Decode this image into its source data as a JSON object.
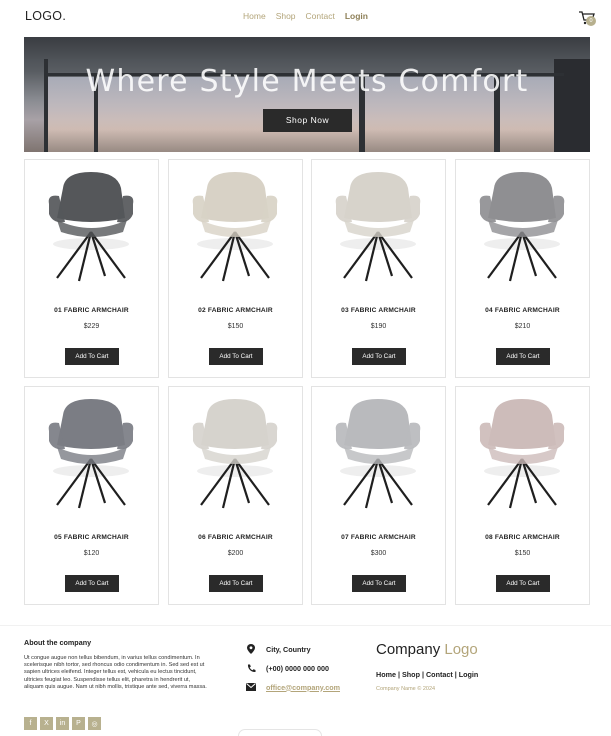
{
  "header": {
    "logo": "LOGO.",
    "nav": [
      "Home",
      "Shop",
      "Contact",
      "Login"
    ],
    "cart_count": "0"
  },
  "hero": {
    "title": "Where Style Meets Comfort",
    "button": "Shop Now"
  },
  "products": [
    {
      "name": "01 FABRIC ARMCHAIR",
      "price": "$229",
      "button": "Add To Cart",
      "color": "#55575a"
    },
    {
      "name": "02 FABRIC ARMCHAIR",
      "price": "$150",
      "button": "Add To Cart",
      "color": "#d8d2c6"
    },
    {
      "name": "03 FABRIC ARMCHAIR",
      "price": "$190",
      "button": "Add To Cart",
      "color": "#d7d3cb"
    },
    {
      "name": "04 FABRIC ARMCHAIR",
      "price": "$210",
      "button": "Add To Cart",
      "color": "#8f8f92"
    },
    {
      "name": "05 FABRIC ARMCHAIR",
      "price": "$120",
      "button": "Add To Cart",
      "color": "#7b7d84"
    },
    {
      "name": "06 FABRIC ARMCHAIR",
      "price": "$200",
      "button": "Add To Cart",
      "color": "#d6d3cd"
    },
    {
      "name": "07 FABRIC ARMCHAIR",
      "price": "$300",
      "button": "Add To Cart",
      "color": "#b9babd"
    },
    {
      "name": "08 FABRIC ARMCHAIR",
      "price": "$150",
      "button": "Add To Cart",
      "color": "#cdbcba"
    }
  ],
  "footer": {
    "about_title": "About the company",
    "about_text": "Ut congue augue non tellus bibendum, in varius tellus condimentum. In scelerisque nibh tortor, sed rhoncus odio condimentum in. Sed sed est ut sapien ultrices eleifend. Integer tellus est, vehicula eu lectus tincidunt, ultricies feugiat leo. Suspendisse tellus elit, pharetra in hendrerit ut, aliquam quis augue. Nam ut nibh mollis, tristique ante sed, viverra massa.",
    "socials": [
      "facebook-icon",
      "x-icon",
      "linkedin-icon",
      "pinterest-icon",
      "instagram-icon"
    ],
    "address": "City, Country",
    "phone": "(+00) 0000 000 000",
    "email": "office@company.com",
    "company_logo_main": "Company",
    "company_logo_accent": "Logo",
    "links": [
      "Home",
      "Shop",
      "Contact",
      "Login"
    ],
    "copyright": "Company Name © 2024"
  },
  "colors": {
    "accent": "#b3a57a",
    "dark": "#2a2a2a"
  }
}
